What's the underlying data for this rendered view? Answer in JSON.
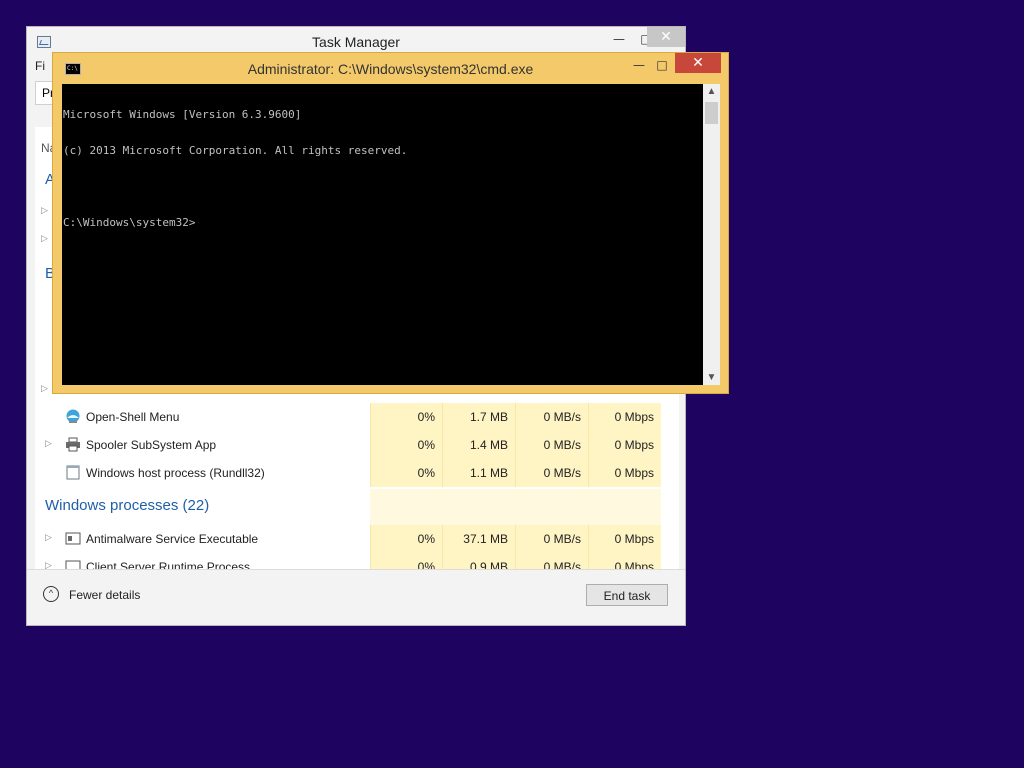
{
  "task_manager": {
    "title": "Task Manager",
    "menu_partial": "Fi",
    "tab_partial": "Pr",
    "column_partial": "Na",
    "section_partial_a": "A",
    "section_partial_b": "B",
    "window_controls": {
      "minimize": "—",
      "maximize": "□",
      "close": "✕"
    },
    "background_rows": [
      {
        "name": "Open-Shell Menu",
        "cpu": "0%",
        "memory": "1.7 MB",
        "disk": "0 MB/s",
        "network": "0 Mbps",
        "icon": "shell-menu-icon",
        "expandable": false
      },
      {
        "name": "Spooler SubSystem App",
        "cpu": "0%",
        "memory": "1.4 MB",
        "disk": "0 MB/s",
        "network": "0 Mbps",
        "icon": "printer-icon",
        "expandable": true
      },
      {
        "name": "Windows host process (Rundll32)",
        "cpu": "0%",
        "memory": "1.1 MB",
        "disk": "0 MB/s",
        "network": "0 Mbps",
        "icon": "app-window-icon",
        "expandable": false
      }
    ],
    "windows_section_title": "Windows processes (22)",
    "windows_rows": [
      {
        "name": "Antimalware Service Executable",
        "cpu": "0%",
        "memory": "37.1 MB",
        "disk": "0 MB/s",
        "network": "0 Mbps",
        "icon": "app-window-icon",
        "expandable": true
      },
      {
        "name": "Client Server Runtime Process",
        "cpu": "0%",
        "memory": "0.9 MB",
        "disk": "0 MB/s",
        "network": "0 Mbps",
        "icon": "app-window-icon",
        "expandable": true
      }
    ],
    "fewer_details": "Fewer details",
    "end_task": "End task"
  },
  "cmd": {
    "title": "Administrator: C:\\Windows\\system32\\cmd.exe",
    "icon_text": "C:\\",
    "window_controls": {
      "minimize": "—",
      "maximize": "□",
      "close": "✕"
    },
    "lines": [
      "Microsoft Windows [Version 6.3.9600]",
      "(c) 2013 Microsoft Corporation. All rights reserved.",
      "",
      "C:\\Windows\\system32>"
    ]
  },
  "colors": {
    "desktop": "#1e0460",
    "cmd_frame": "#f3c969",
    "close_red": "#c7483a",
    "section_blue": "#1f5fa9",
    "heat_yellow": "#fff4c4"
  }
}
